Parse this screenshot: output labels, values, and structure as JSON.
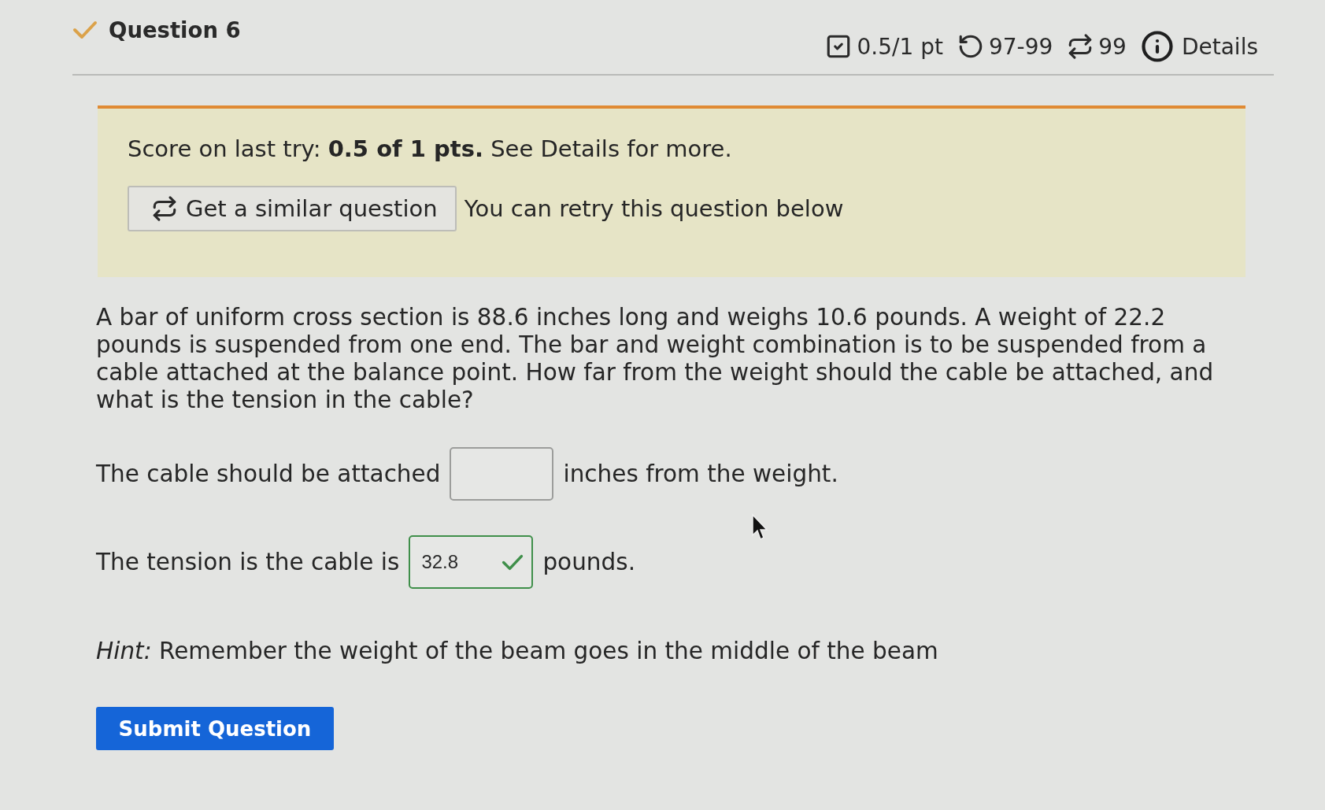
{
  "question": {
    "title": "Question 6"
  },
  "meta": [
    {
      "kind": "score",
      "text": "0.5/1 pt"
    },
    {
      "kind": "attempts",
      "text": "97-99"
    },
    {
      "kind": "retries",
      "text": "99"
    },
    {
      "kind": "details",
      "text": "Details"
    }
  ],
  "banner": {
    "score": "Score on last try: **0.5 of 1 pts.** See Details for more.",
    "similar_button": "Get a similar question",
    "retry_note": "You can retry this question below"
  },
  "question_text": "A bar of uniform cross section is 88.6 inches long and weighs 10.6 pounds. A weight of 22.2 pounds is suspended from one end. The bar and weight combination is to be suspended from a cable attached at the balance point. How far from the weight should the cable be attached, and what is the tension in the cable?",
  "answers": [
    {
      "before": "The cable should be attached",
      "after": "inches from the weight.",
      "correct": false
    },
    {
      "before": "The tension is the cable is",
      "value": "32.8",
      "after": "pounds.",
      "correct": true
    }
  ],
  "hint": "*Hint:* Remember the weight of the beam goes in the middle of the beam",
  "submit_button": "Submit Question"
}
